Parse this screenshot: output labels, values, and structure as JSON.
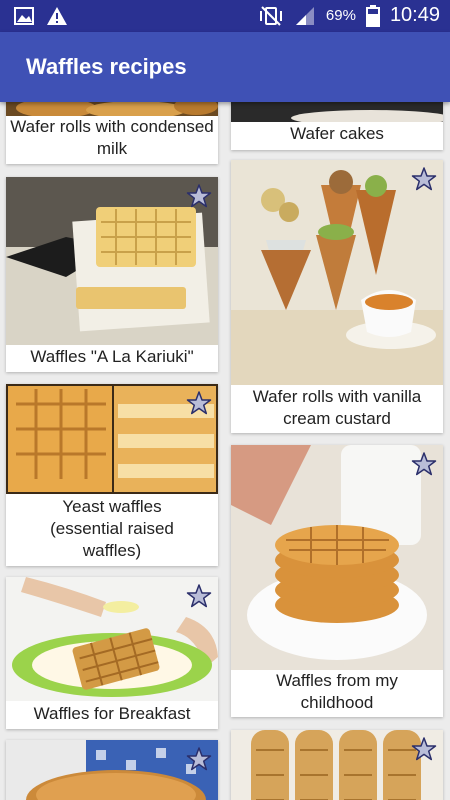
{
  "statusbar": {
    "battery": "69%",
    "time": "10:49"
  },
  "appbar": {
    "title": "Waffles recipes"
  },
  "cards": [
    {
      "label": "Wafer rolls with condensed milk"
    },
    {
      "label": "Wafer cakes"
    },
    {
      "label": "Waffles \"A La Kariuki\""
    },
    {
      "label": "Wafer rolls with vanilla cream custard"
    },
    {
      "label": "Yeast waffles (essential raised waffles)"
    },
    {
      "label": "Waffles from my childhood"
    },
    {
      "label": "Waffles for Breakfast"
    },
    {
      "label": ""
    },
    {
      "label": ""
    }
  ],
  "icons": {
    "favorite": "star-icon"
  }
}
